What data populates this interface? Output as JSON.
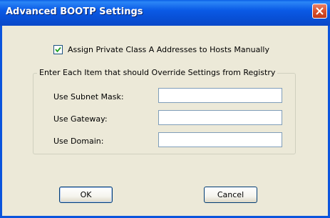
{
  "window": {
    "title": "Advanced BOOTP Settings",
    "close_icon": "close-icon"
  },
  "checkbox": {
    "label": "Assign Private Class A Addresses to Hosts Manually",
    "checked": true
  },
  "group": {
    "label": "Enter Each Item that should Override Settings from Registry",
    "fields": [
      {
        "label": "Use Subnet Mask:",
        "value": ""
      },
      {
        "label": "Use Gateway:",
        "value": ""
      },
      {
        "label": "Use Domain:",
        "value": ""
      }
    ]
  },
  "buttons": {
    "ok": "OK",
    "cancel": "Cancel"
  },
  "colors": {
    "titlebar": "#0a54dd",
    "face": "#ece9d8",
    "close": "#d9512c"
  }
}
